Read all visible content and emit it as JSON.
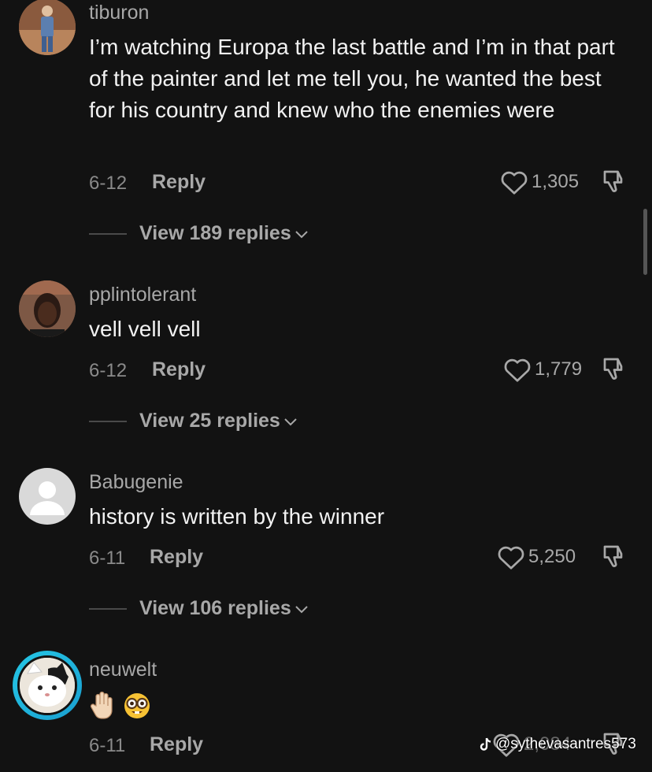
{
  "comments": [
    {
      "username": "tiburon",
      "text": "I’m watching Europa the last battle and I’m in that part of the painter and let me tell you, he wanted the best for his country and knew who the enemies were",
      "date": "6-12",
      "reply_label": "Reply",
      "likes": "1,305",
      "view_replies": "View 189 replies"
    },
    {
      "username": "pplintolerant",
      "text": "vell vell vell",
      "date": "6-12",
      "reply_label": "Reply",
      "likes": "1,779",
      "view_replies": "View 25 replies"
    },
    {
      "username": "Babugenie",
      "text": "history is written by the winner",
      "date": "6-11",
      "reply_label": "Reply",
      "likes": "5,250",
      "view_replies": "View 106 replies"
    },
    {
      "username": "neuwelt",
      "emojis": [
        "raised-hand-emoji",
        "nerd-face-emoji"
      ],
      "date": "6-11",
      "reply_label": "Reply",
      "likes": "2,084"
    }
  ],
  "watermark": "@sythevasantres573",
  "colors": {
    "background": "#121212",
    "muted_text": "#a8a8a8",
    "story_ring": "#25c7e6"
  }
}
